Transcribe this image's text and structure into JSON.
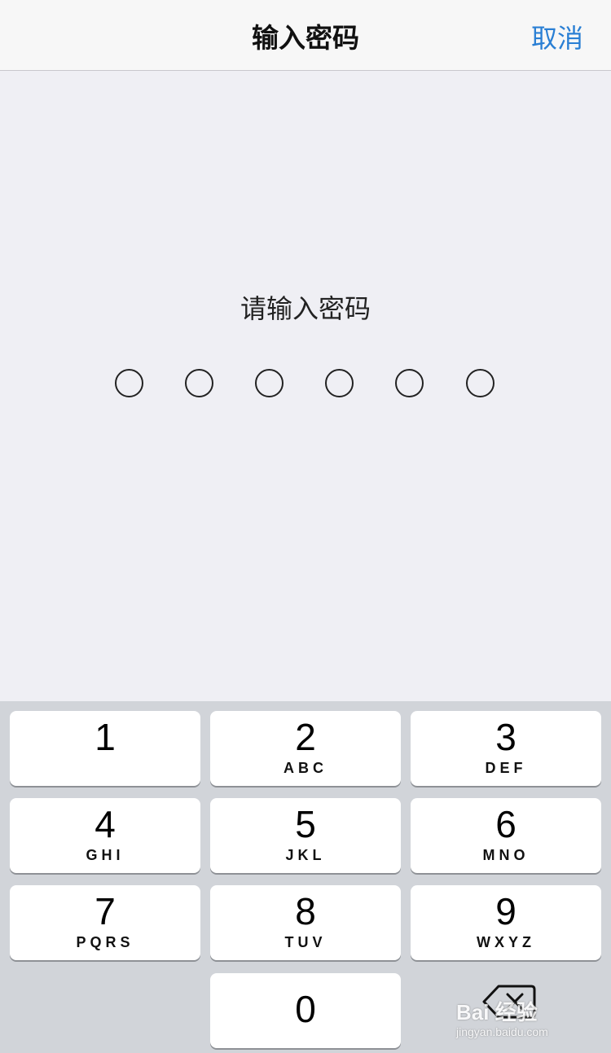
{
  "navbar": {
    "title": "输入密码",
    "cancel_label": "取消"
  },
  "prompt": {
    "text": "请输入密码"
  },
  "passcode": {
    "digits_total": 6,
    "digits_entered": 0
  },
  "keypad": {
    "keys": [
      {
        "num": "1",
        "letters": ""
      },
      {
        "num": "2",
        "letters": "ABC"
      },
      {
        "num": "3",
        "letters": "DEF"
      },
      {
        "num": "4",
        "letters": "GHI"
      },
      {
        "num": "5",
        "letters": "JKL"
      },
      {
        "num": "6",
        "letters": "MNO"
      },
      {
        "num": "7",
        "letters": "PQRS"
      },
      {
        "num": "8",
        "letters": "TUV"
      },
      {
        "num": "9",
        "letters": "WXYZ"
      },
      {
        "num": "0",
        "letters": ""
      }
    ],
    "backspace_icon": "backspace-icon"
  },
  "watermark": {
    "brand": "Bai 经验",
    "url": "jingyan.baidu.com"
  },
  "colors": {
    "accent": "#2a7fd4",
    "background": "#efeff4",
    "keypad_background": "#d1d4d9"
  }
}
